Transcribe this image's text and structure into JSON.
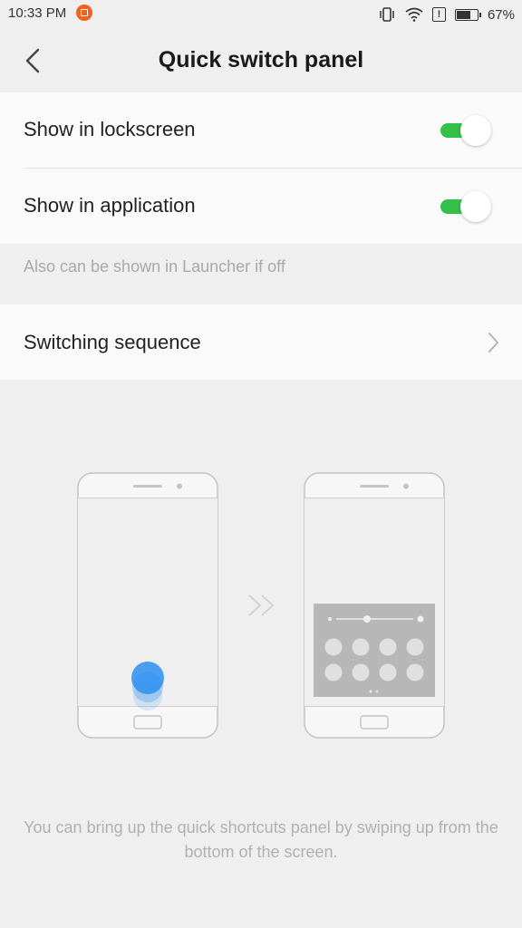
{
  "status_bar": {
    "time": "10:33 PM",
    "battery_percent": "67%",
    "battery_level": 0.67,
    "icons": [
      "notification-icon",
      "vibrate-icon",
      "wifi-icon",
      "alert-icon",
      "battery-icon"
    ]
  },
  "header": {
    "title": "Quick switch panel",
    "back_icon": "chevron-left-icon"
  },
  "settings": {
    "show_in_lockscreen": {
      "label": "Show in lockscreen",
      "enabled": true
    },
    "show_in_application": {
      "label": "Show in application",
      "enabled": true
    },
    "hint": "Also can be shown in Launcher if off",
    "switching_sequence": {
      "label": "Switching sequence",
      "icon": "chevron-right-icon"
    }
  },
  "illustration": {
    "footer": "You can bring up the quick shortcuts panel by swiping up from the bottom of the screen."
  },
  "colors": {
    "toggle_on": "#35c04a",
    "accent_blue": "#2b8ff0",
    "notification_orange": "#f0621e"
  }
}
